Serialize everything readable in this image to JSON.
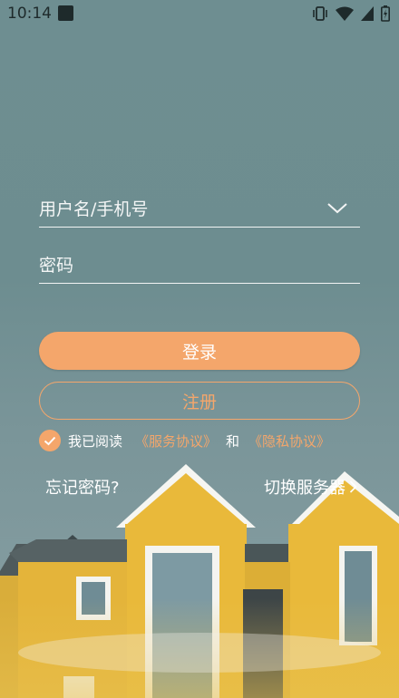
{
  "status_bar": {
    "time": "10:14",
    "icons": [
      "app-icon",
      "vibrate-icon",
      "wifi-icon",
      "signal-icon",
      "battery-icon"
    ]
  },
  "form": {
    "username_placeholder": "用户名/手机号",
    "password_placeholder": "密码",
    "login_label": "登录",
    "register_label": "注册",
    "agree_text": "我已阅读",
    "service_link": "《服务协议》",
    "and_text": "和",
    "privacy_link": "《隐私协议》",
    "agree_checked": true,
    "forgot_label": "忘记密码?",
    "switch_server_label": "切换服务器"
  },
  "colors": {
    "accent": "#f4a66b",
    "background": "#6e8e91",
    "house_yellow": "#e9b93a"
  }
}
